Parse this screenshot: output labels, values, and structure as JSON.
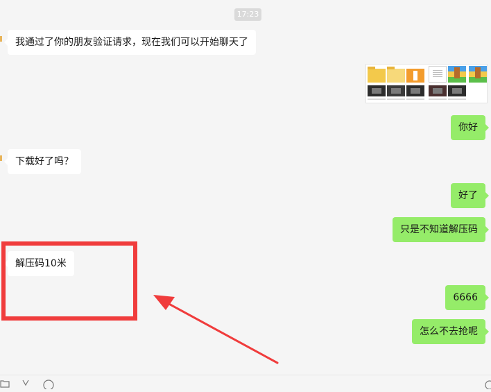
{
  "chat": {
    "timestamp": "17:23",
    "messages": [
      {
        "side": "left",
        "text": "我通过了你的朋友验证请求，现在我们可以开始聊天了"
      },
      {
        "side": "right",
        "type": "file-preview"
      },
      {
        "side": "right",
        "text": "你好"
      },
      {
        "side": "left",
        "text": "下载好了吗？"
      },
      {
        "side": "right",
        "text": "好了"
      },
      {
        "side": "right",
        "text": "只是不知道解压码"
      },
      {
        "side": "left",
        "text": "解压码10米"
      },
      {
        "side": "right",
        "text": "6666"
      },
      {
        "side": "right",
        "text": "怎么不去抢呢"
      }
    ]
  },
  "colors": {
    "chat_background": "#f5f5f5",
    "incoming_bubble": "#ffffff",
    "outgoing_bubble": "#95ec69",
    "annotation_red": "#f03c3c"
  },
  "toolbar": {
    "icons": [
      "folder-icon",
      "scissors-icon",
      "emoji-icon",
      "settings-icon"
    ]
  }
}
